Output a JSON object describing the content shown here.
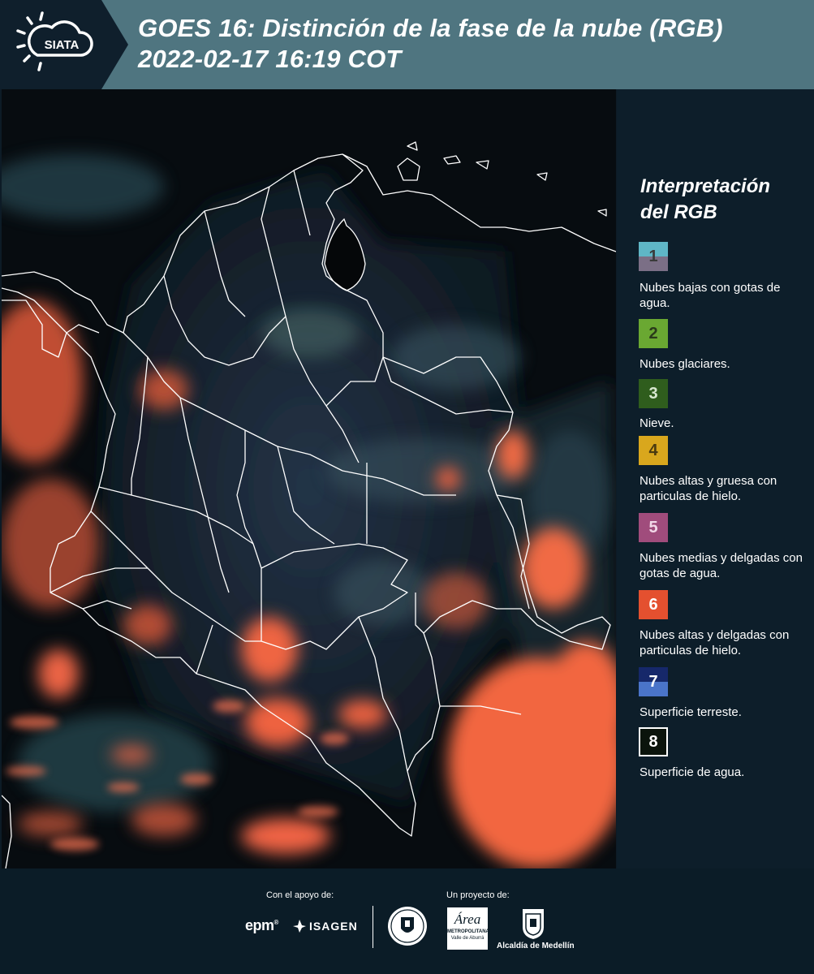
{
  "header": {
    "logo_text": "SIATA",
    "title_line1": "GOES 16: Distinción de la fase de la nube (RGB)",
    "title_line2": " 2022-02-17 16:19 COT"
  },
  "legend": {
    "title_line1": "Interpretación",
    "title_line2": "del RGB",
    "items": [
      {
        "num": "1",
        "label": "Nubes bajas con gotas de agua.",
        "color_top": "#5fb6c6",
        "color_bottom": "#7b6f86",
        "text_color": "#3a3a3a"
      },
      {
        "num": "2",
        "label": "Nubes glaciares.",
        "color_top": "#6aa832",
        "color_bottom": "#6aa832",
        "text_color": "#2a3a1a"
      },
      {
        "num": "3",
        "label": "Nieve.",
        "color_top": "#2f5d1d",
        "color_bottom": "#2f5d1d",
        "text_color": "#d8e8d0"
      },
      {
        "num": "4",
        "label": "Nubes altas y gruesa con particulas de hielo.",
        "color_top": "#d9a71d",
        "color_bottom": "#d9a71d",
        "text_color": "#4a3a10"
      },
      {
        "num": "5",
        "label": "Nubes medias y delgadas con gotas de agua.",
        "color_top": "#a04c7c",
        "color_bottom": "#a04c7c",
        "text_color": "#f2d8e8"
      },
      {
        "num": "6",
        "label": "Nubes altas y delgadas con particulas de hielo.",
        "color_top": "#e4502f",
        "color_bottom": "#e4502f",
        "text_color": "#ffffff"
      },
      {
        "num": "7",
        "label": "Superficie terreste.",
        "color_top": "#16286a",
        "color_bottom": "#4a74c9",
        "text_color": "#ffffff"
      },
      {
        "num": "8",
        "label": "Superficie de agua.",
        "color_top": "#0b140c",
        "color_bottom": "#0b140c",
        "text_color": "#ffffff"
      }
    ]
  },
  "footer": {
    "support_label": "Con el apoyo de:",
    "project_label": "Un proyecto de:",
    "sponsor1": "epm",
    "sponsor2": "ISAGEN",
    "partner_area": "Área",
    "partner_area_sub1": "METROPOLITANA",
    "partner_area_sub2": "Valle de Aburrá",
    "partner_alcaldia": "Alcaldía de Medellín"
  }
}
